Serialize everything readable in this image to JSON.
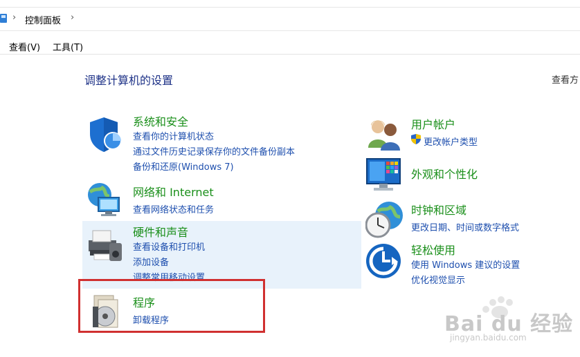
{
  "address": {
    "crumb": "控制面板",
    "separator": "›"
  },
  "menu": {
    "view": "查看(V)",
    "tools": "工具(T)"
  },
  "page": {
    "title": "调整计算机的设置",
    "view_by": "查看方"
  },
  "left_categories": [
    {
      "title": "系统和安全",
      "links": [
        "查看你的计算机状态",
        "通过文件历史记录保存你的文件备份副本",
        "备份和还原(Windows 7)"
      ]
    },
    {
      "title": "网络和 Internet",
      "links": [
        "查看网络状态和任务"
      ]
    },
    {
      "title": "硬件和声音",
      "links": [
        "查看设备和打印机",
        "添加设备",
        "调整常用移动设置"
      ]
    },
    {
      "title": "程序",
      "links": [
        "卸载程序"
      ]
    }
  ],
  "right_categories": [
    {
      "title": "用户帐户",
      "links": [
        "更改帐户类型"
      ]
    },
    {
      "title": "外观和个性化",
      "links": []
    },
    {
      "title": "时钟和区域",
      "links": [
        "更改日期、时间或数字格式"
      ]
    },
    {
      "title": "轻松使用",
      "links": [
        "使用 Windows 建议的设置",
        "优化视觉显示"
      ]
    }
  ],
  "watermark": {
    "brand": "Bai du 经验",
    "url": "jingyan.baidu.com"
  },
  "colors": {
    "title_green": "#1a8f1a",
    "link_blue": "#1e4fae",
    "heading_blue": "#1e3287",
    "highlight": "#e8f2fb",
    "red_box": "#d03030"
  }
}
